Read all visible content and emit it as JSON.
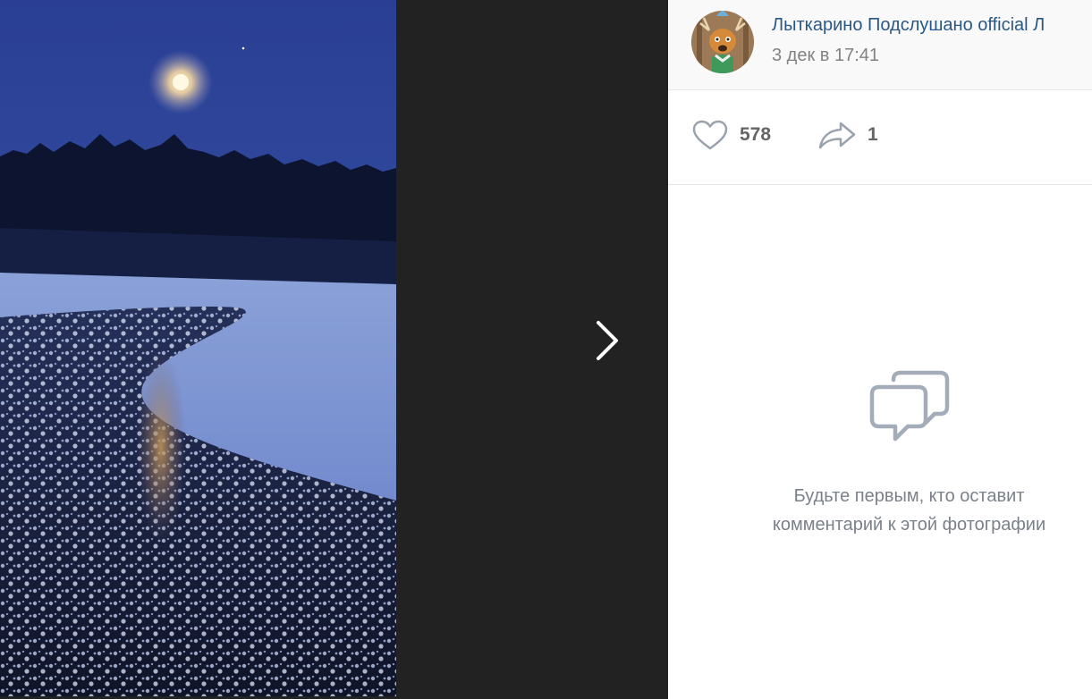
{
  "viewer": {
    "next_icon": "chevron-right-icon"
  },
  "post": {
    "author": "Лыткарино Подслушано official Л",
    "date": "3 дек в 17:41",
    "avatar_icon": "reindeer-avatar"
  },
  "actions": {
    "like_icon": "heart-icon",
    "likes": "578",
    "share_icon": "share-arrow-icon",
    "shares": "1"
  },
  "comments": {
    "empty_icon": "comments-icon",
    "empty_line1": "Будьте первым, кто оставит",
    "empty_line2": "комментарий к этой фотографии"
  },
  "colors": {
    "viewer_bg": "#222222",
    "link": "#2a5885",
    "muted": "#828282",
    "counter": "#656565"
  }
}
